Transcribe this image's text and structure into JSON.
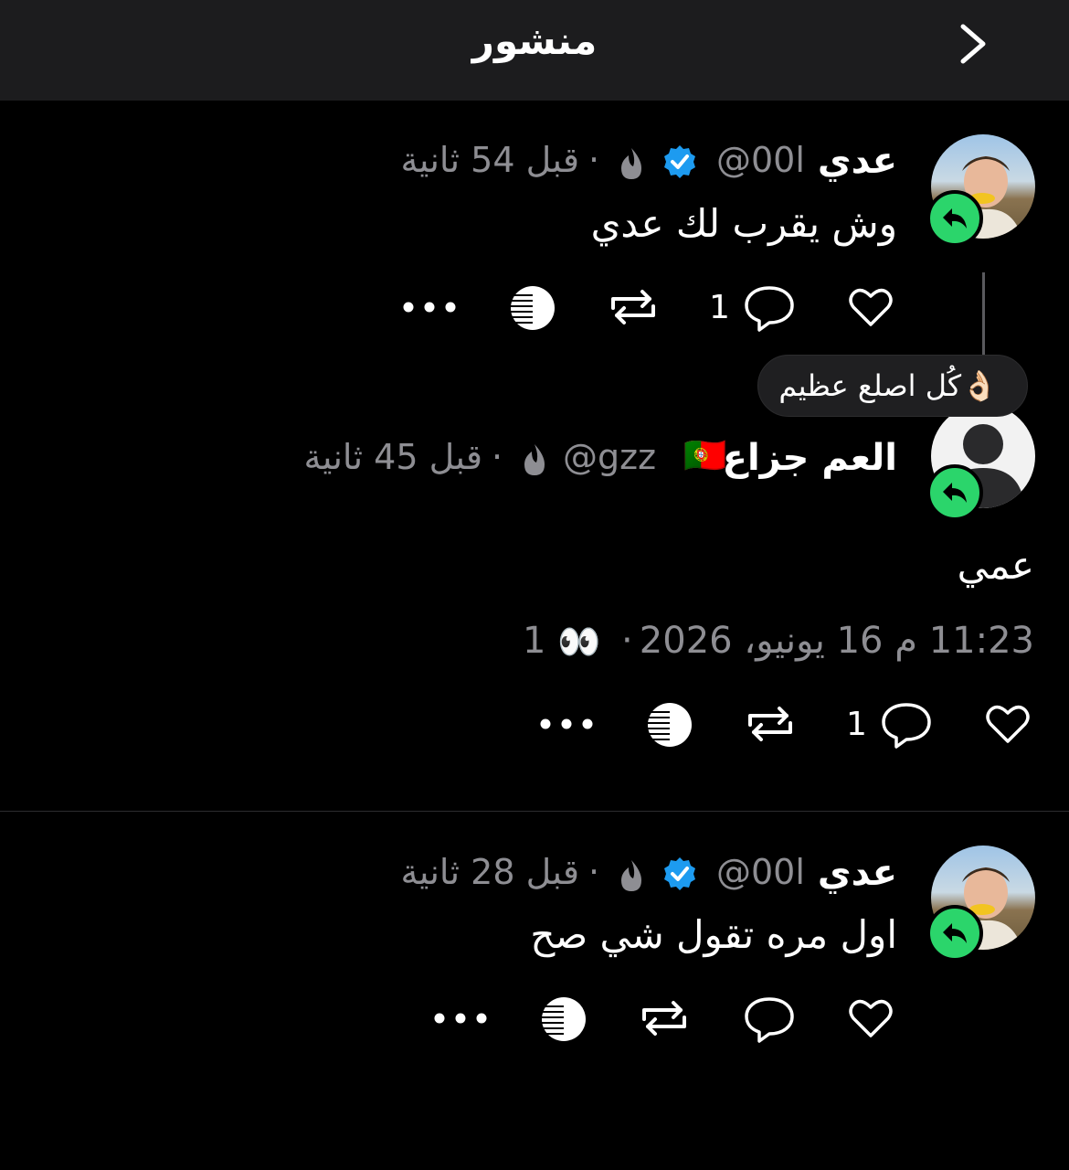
{
  "header": {
    "title": "منشور",
    "back_icon": "chevron-right-icon"
  },
  "posts": [
    {
      "author_name": "عدي",
      "handle": "@00ا",
      "time": "قبل 54 ثانية",
      "separator": "·",
      "text": "وش يقرب لك عدي",
      "reply_count": "1",
      "verified": true
    },
    {
      "author_name": "العم جزاع",
      "flag": "🇵🇹",
      "handle": "@gzz",
      "time": "قبل 45 ثانية",
      "separator": "·",
      "text": "عمي",
      "timestamp": "11:23 م 16 يونيو، 2026",
      "views_separator": "·",
      "view_emoji": "👀",
      "views": "1",
      "reply_count": "1"
    },
    {
      "author_name": "عدي",
      "handle": "@00ا",
      "time": "قبل 28 ثانية",
      "separator": "·",
      "text": "اول مره تقول شي صح",
      "verified": true
    }
  ],
  "tooltip": {
    "text": "كُل اصلع عظيم",
    "emoji": "👌🏻"
  },
  "colors": {
    "background": "#000000",
    "header": "#1c1c1e",
    "muted": "#8e8e93",
    "verified": "#1d9bf0",
    "reply_badge": "#2bd56b"
  }
}
